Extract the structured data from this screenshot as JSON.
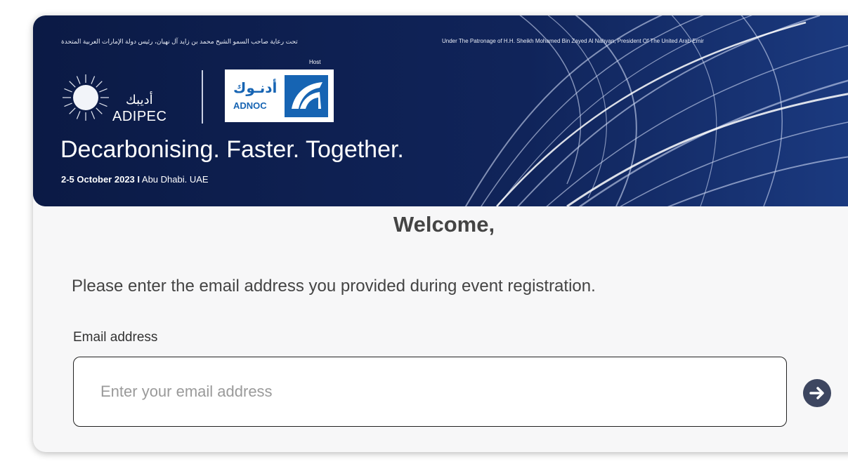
{
  "banner": {
    "patronage_ar": "تحت رعاية صاحب السمو الشيخ محمد بن زايد آل نهيان، رئيس دولة الإمارات العربية المتحدة",
    "patronage_en": "Under The Patronage of H.H. Sheikh Mohamed Bin Zayed Al Nahyan, President Of The United Arab Emir",
    "adipec_ar": "أديبك",
    "adipec_en": "ADIPEC",
    "host_label": "Host",
    "adnoc_ar": "أدنـوك",
    "adnoc_en": "ADNOC",
    "tagline": "Decarbonising. Faster. Together.",
    "dates_bold": "2-5 October 2023 I",
    "dates_place": "Abu Dhabi. UAE",
    "background_color": "#0d1f4f"
  },
  "form": {
    "welcome": "Welcome,",
    "instruction": "Please enter the email address you provided during event registration.",
    "email_label": "Email address",
    "email_placeholder": "Enter your email address",
    "email_value": "",
    "submit_icon": "arrow-right-icon",
    "submit_color": "#3d4660"
  }
}
